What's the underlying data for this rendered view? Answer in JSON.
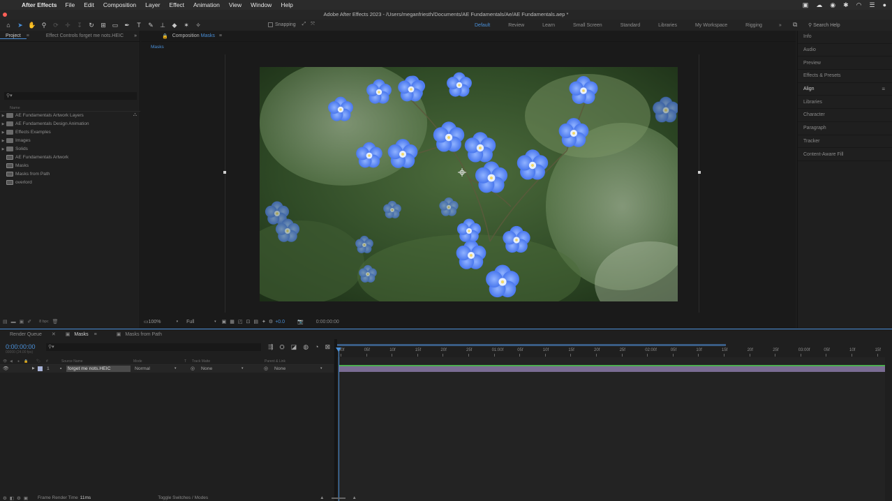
{
  "menubar": {
    "app": "After Effects",
    "items": [
      "File",
      "Edit",
      "Composition",
      "Layer",
      "Effect",
      "Animation",
      "View",
      "Window",
      "Help"
    ]
  },
  "titlebar": {
    "title": "Adobe After Effects 2023 - /Users/meganfriesth/Documents/AE Fundamentals/Ae/AE Fundamentals.aep *"
  },
  "toolbar": {
    "snapping": "Snapping",
    "workspaces": [
      "Default",
      "Review",
      "Learn",
      "Small Screen",
      "Standard",
      "Libraries",
      "My Workspace",
      "Rigging"
    ],
    "active_workspace": "Default",
    "search_placeholder": "Search Help"
  },
  "project": {
    "tabs": [
      "Project",
      "Effect Controls forget me nots.HEIC"
    ],
    "column_name": "Name",
    "items": [
      {
        "label": "AE Fundamentals Artwork Layers",
        "type": "folder"
      },
      {
        "label": "AE Fundamentals Design Animation",
        "type": "folder"
      },
      {
        "label": "Effects Examples",
        "type": "folder"
      },
      {
        "label": "Images",
        "type": "folder"
      },
      {
        "label": "Solids",
        "type": "folder"
      },
      {
        "label": "AE Fundamentals Artwork",
        "type": "comp"
      },
      {
        "label": "Masks",
        "type": "comp"
      },
      {
        "label": "Masks from Path",
        "type": "comp"
      },
      {
        "label": "overlord",
        "type": "comp"
      }
    ],
    "bpc": "8 bpc"
  },
  "composition": {
    "tab_prefix": "Composition",
    "tab_name": "Masks",
    "sub_tab": "Masks",
    "zoom": "100%",
    "resolution": "Full",
    "exposure": "+0.0",
    "timecode": "0:00:00:00"
  },
  "right_panels": [
    "Info",
    "Audio",
    "Preview",
    "Effects & Presets",
    "Align",
    "Libraries",
    "Character",
    "Paragraph",
    "Tracker",
    "Content-Aware Fill"
  ],
  "right_active": "Align",
  "timeline": {
    "tabs": [
      "Render Queue",
      "Masks",
      "Masks from Path"
    ],
    "active_tab": "Masks",
    "timecode": "0:00:00:00",
    "timecode_sub": "00000 (24.00 fps)",
    "headers": {
      "source_name": "Source Name",
      "mode": "Mode",
      "t": "T",
      "track_matte": "Track Matte",
      "parent": "Parent & Link"
    },
    "layer": {
      "index": "1",
      "name": "forget me nots.HEIC",
      "mode": "Normal",
      "matte": "None",
      "parent": "None"
    },
    "ruler": [
      "00f",
      "05f",
      "10f",
      "15f",
      "20f",
      "25f",
      "01:00f",
      "05f",
      "10f",
      "15f",
      "20f",
      "25f",
      "02:00f",
      "05f",
      "10f",
      "15f",
      "20f",
      "25f",
      "03:00f",
      "05f",
      "10f",
      "15f"
    ],
    "frame_render_label": "Frame Render Time",
    "frame_render_value": "11ms",
    "toggle_label": "Toggle Switches / Modes"
  },
  "colors": {
    "accent": "#4a90d9",
    "layer_bar": "#7a6c93",
    "track_top": "#4caf50"
  }
}
